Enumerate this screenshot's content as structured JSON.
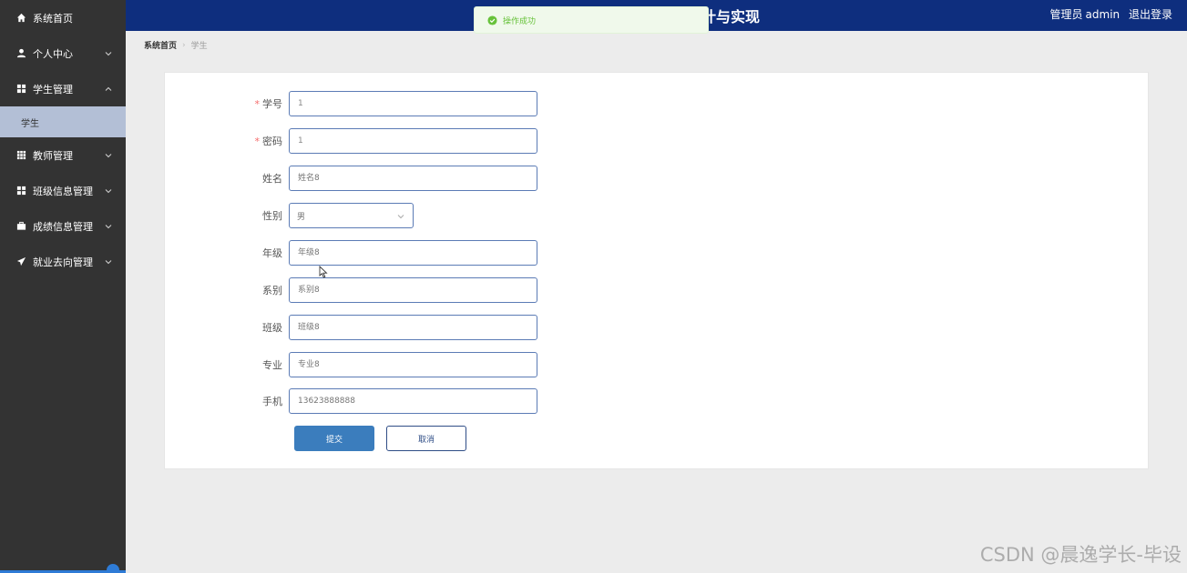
{
  "sidebar": {
    "items": [
      {
        "label": "系统首页",
        "icon": "home-icon"
      },
      {
        "label": "个人中心",
        "icon": "user-icon"
      },
      {
        "label": "学生管理",
        "icon": "grid-icon",
        "expanded": true,
        "sub": [
          {
            "label": "学生",
            "active": true
          }
        ]
      },
      {
        "label": "教师管理",
        "icon": "table-icon"
      },
      {
        "label": "班级信息管理",
        "icon": "grid-icon"
      },
      {
        "label": "成绩信息管理",
        "icon": "briefcase-icon"
      },
      {
        "label": "就业去向管理",
        "icon": "send-icon"
      }
    ]
  },
  "header": {
    "title": "计与实现",
    "role": "管理员",
    "username": "admin",
    "logout": "退出登录"
  },
  "toast": {
    "message": "操作成功",
    "type": "success"
  },
  "breadcrumb": {
    "home": "系统首页",
    "current": "学生"
  },
  "form": {
    "fields": [
      {
        "label": "学号",
        "required": true,
        "value": "1",
        "placeholder": ""
      },
      {
        "label": "密码",
        "required": true,
        "value": "1",
        "placeholder": ""
      },
      {
        "label": "姓名",
        "required": false,
        "value": "",
        "placeholder": "姓名8"
      },
      {
        "label": "性别",
        "required": false,
        "type": "select",
        "value": "男"
      },
      {
        "label": "年级",
        "required": false,
        "value": "",
        "placeholder": "年级8"
      },
      {
        "label": "系别",
        "required": false,
        "value": "",
        "placeholder": "系别8"
      },
      {
        "label": "班级",
        "required": false,
        "value": "",
        "placeholder": "班级8"
      },
      {
        "label": "专业",
        "required": false,
        "value": "",
        "placeholder": "专业8"
      },
      {
        "label": "手机",
        "required": false,
        "value": "",
        "placeholder": "13623888888"
      }
    ],
    "submit": "提交",
    "cancel": "取消"
  },
  "watermark": "CSDN @晨逸学长-毕设",
  "colors": {
    "sidebar": "#333333",
    "header": "#0e2e7e",
    "active_sub": "#b3bfd6",
    "primary": "#3b7dbd",
    "success": "#67c23a",
    "required": "#f56c6c"
  }
}
